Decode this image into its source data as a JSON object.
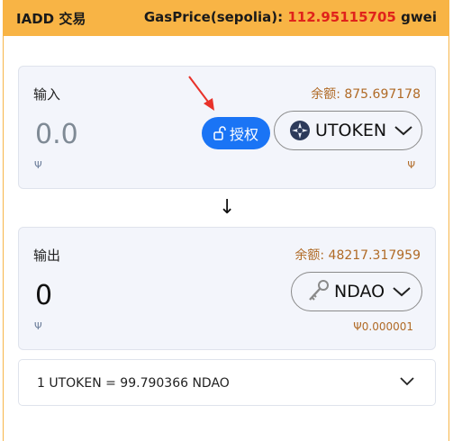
{
  "header": {
    "title": "IADD 交易",
    "gas_label": "GasPrice(sepolia):",
    "gas_value": "112.95115705",
    "gas_unit": "gwei",
    "accent_color": "#f8b445"
  },
  "input_panel": {
    "label": "输入",
    "balance": "余额: 875.697178",
    "amount": "0.0",
    "approve_label": "授权",
    "token": {
      "name": "UTOKEN",
      "icon": "utoken-logo-icon"
    },
    "left_icon_glyph": "Ψ",
    "right_icon_glyph": "Ψ"
  },
  "swap": {
    "arrow_glyph": "↓",
    "icon": "arrow-down-icon"
  },
  "output_panel": {
    "label": "输出",
    "balance": "余额: 48217.317959",
    "amount": "0",
    "token": {
      "name": "NDAO",
      "icon": "key-icon"
    },
    "left_icon_glyph": "Ψ",
    "fee": "Ψ0.000001"
  },
  "rate": {
    "text": "1 UTOKEN = 99.790366 NDAO",
    "icon": "chevron-down-icon"
  },
  "colors": {
    "approve": "#1a74f5",
    "balance": "#b06a26",
    "gas_value": "#e0231b"
  }
}
